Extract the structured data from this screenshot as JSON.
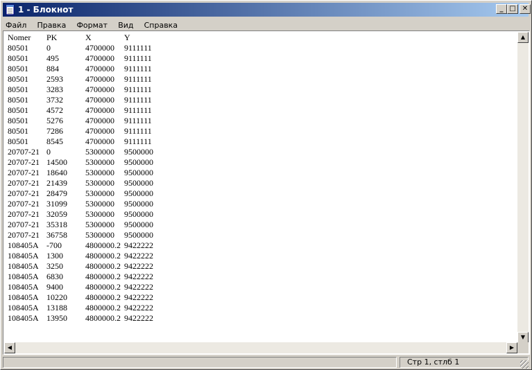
{
  "window": {
    "title": "1 - Блокнот"
  },
  "menu": [
    "Файл",
    "Правка",
    "Формат",
    "Вид",
    "Справка"
  ],
  "document": {
    "lines": [
      [
        "Nomer",
        "PK",
        "X",
        "Y"
      ],
      [
        "80501",
        "0",
        "4700000",
        "9111111"
      ],
      [
        "80501",
        "495",
        "4700000",
        "9111111"
      ],
      [
        "80501",
        "884",
        "4700000",
        "9111111"
      ],
      [
        "80501",
        "2593",
        "4700000",
        "9111111"
      ],
      [
        "80501",
        "3283",
        "4700000",
        "9111111"
      ],
      [
        "80501",
        "3732",
        "4700000",
        "9111111"
      ],
      [
        "80501",
        "4572",
        "4700000",
        "9111111"
      ],
      [
        "80501",
        "5276",
        "4700000",
        "9111111"
      ],
      [
        "80501",
        "7286",
        "4700000",
        "9111111"
      ],
      [
        "80501",
        "8545",
        "4700000",
        "9111111"
      ],
      [
        "20707-21",
        "0",
        "5300000",
        "9500000"
      ],
      [
        "20707-21",
        "14500",
        "5300000",
        "9500000"
      ],
      [
        "20707-21",
        "18640",
        "5300000",
        "9500000"
      ],
      [
        "20707-21",
        "21439",
        "5300000",
        "9500000"
      ],
      [
        "20707-21",
        "28479",
        "5300000",
        "9500000"
      ],
      [
        "20707-21",
        "31099",
        "5300000",
        "9500000"
      ],
      [
        "20707-21",
        "32059",
        "5300000",
        "9500000"
      ],
      [
        "20707-21",
        "35318",
        "5300000",
        "9500000"
      ],
      [
        "20707-21",
        "36758",
        "5300000",
        "9500000"
      ],
      [
        "108405A",
        "-700",
        "4800000.2",
        "9422222"
      ],
      [
        "108405A",
        "1300",
        "4800000.2",
        "9422222"
      ],
      [
        "108405A",
        "3250",
        "4800000.2",
        "9422222"
      ],
      [
        "108405A",
        "6830",
        "4800000.2",
        "9422222"
      ],
      [
        "108405A",
        "9400",
        "4800000.2",
        "9422222"
      ],
      [
        "108405A",
        "10220",
        "4800000.2",
        "9422222"
      ],
      [
        "108405A",
        "13188",
        "4800000.2",
        "9422222"
      ],
      [
        "108405A",
        "13950",
        "4800000.2",
        "9422222"
      ]
    ]
  },
  "status": {
    "position": "Стр 1, стлб 1"
  },
  "icons": {
    "app": "notepad-icon",
    "minimize": "minimize-icon",
    "maximize": "maximize-icon",
    "close": "close-icon",
    "scroll_up": "arrow-up-icon",
    "scroll_down": "arrow-down-icon",
    "scroll_left": "arrow-left-icon",
    "scroll_right": "arrow-right-icon"
  }
}
